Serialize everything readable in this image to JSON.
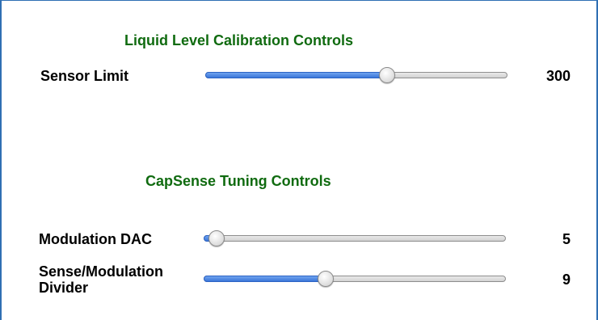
{
  "liquid_section": {
    "title": "Liquid Level Calibration Controls",
    "sensor_limit": {
      "label": "Sensor Limit",
      "value": "300",
      "level": 0.6
    }
  },
  "capsense_section": {
    "title": "CapSense Tuning Controls",
    "modulation_dac": {
      "label": "Modulation DAC",
      "value": "5",
      "level": 0.04
    },
    "sense_modulation_divider": {
      "label_line1": "Sense/Modulation",
      "label_line2": "Divider",
      "value": "9",
      "level": 0.4
    }
  },
  "colors": {
    "section_title": "#106b10",
    "slider_fill": "#3b76d9",
    "frame_border": "#2f6fb3"
  }
}
